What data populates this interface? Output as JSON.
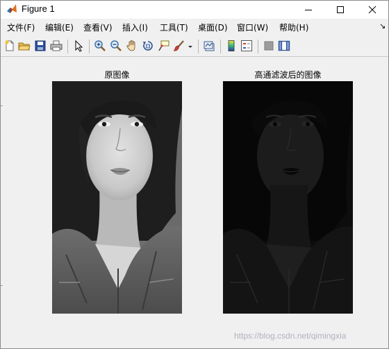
{
  "window": {
    "title": "Figure 1",
    "controls": {
      "minimize": "—",
      "maximize": "□",
      "close": "✕"
    }
  },
  "menu": {
    "items": [
      "文件(F)",
      "编辑(E)",
      "查看(V)",
      "插入(I)",
      "工具(T)",
      "桌面(D)",
      "窗口(W)",
      "帮助(H)"
    ],
    "overflow_icon": "dock-arrow-icon"
  },
  "toolbar": {
    "icons": [
      "new-figure-icon",
      "open-file-icon",
      "save-icon",
      "print-icon",
      "edit-plot-icon",
      "zoom-in-icon",
      "zoom-out-icon",
      "pan-icon",
      "rotate-3d-icon",
      "data-cursor-icon",
      "brush-icon",
      "link-plot-icon",
      "colorbar-icon",
      "legend-icon",
      "hide-plot-tools-icon",
      "show-plot-tools-icon"
    ]
  },
  "figure": {
    "axes": [
      {
        "title": "原图像"
      },
      {
        "title": "高通滤波后的图像"
      }
    ]
  },
  "watermark": "https://blog.csdn.net/qimingxia"
}
